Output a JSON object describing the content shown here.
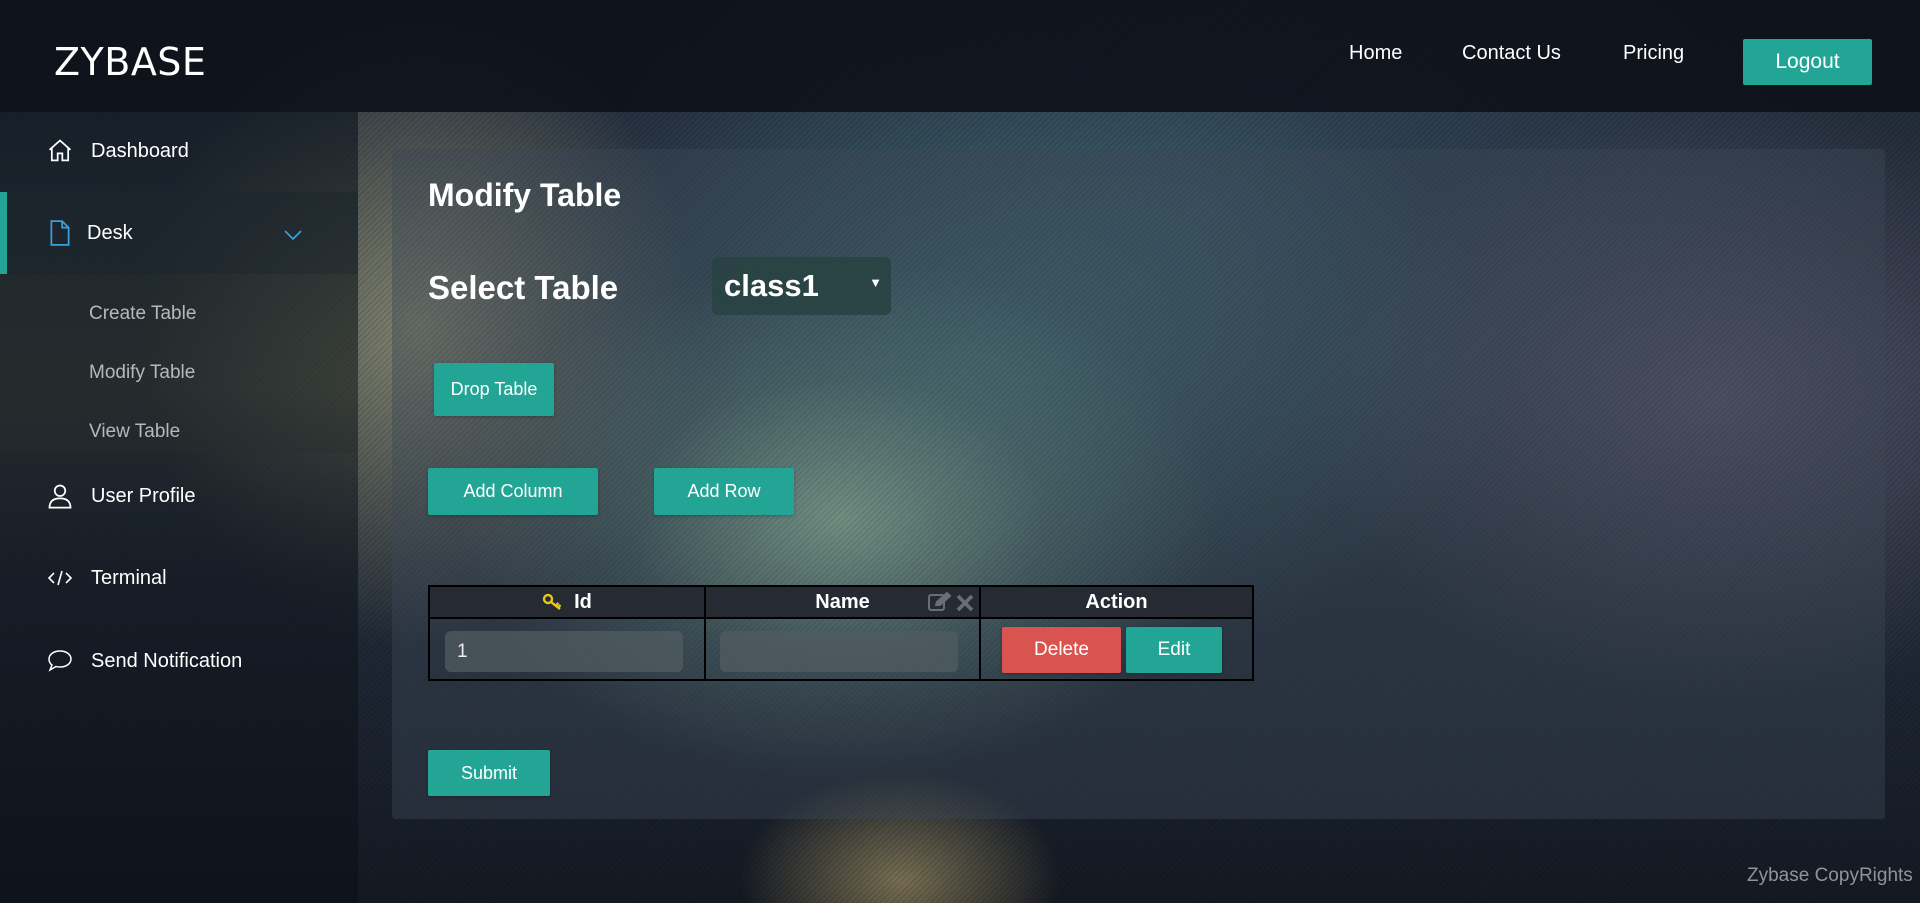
{
  "app": {
    "brand": "ZYBASE"
  },
  "nav": {
    "home": "Home",
    "contact": "Contact Us",
    "pricing": "Pricing",
    "logout": "Logout"
  },
  "sidebar": {
    "dashboard": "Dashboard",
    "desk": "Desk",
    "submenu": [
      "Create Table",
      "Modify Table",
      "View Table"
    ],
    "user_profile": "User Profile",
    "terminal": "Terminal",
    "send_notification": "Send Notification"
  },
  "main": {
    "title": "Modify Table",
    "select_label": "Select Table",
    "selected_table": "class1",
    "drop_table": "Drop Table",
    "add_column": "Add Column",
    "add_row": "Add Row",
    "submit": "Submit"
  },
  "table": {
    "headers": [
      "Id",
      "Name",
      "Action"
    ],
    "rows": [
      {
        "id": "1",
        "name": "",
        "delete": "Delete",
        "edit": "Edit"
      }
    ]
  },
  "footer": {
    "copyright": "Zybase CopyRights"
  },
  "colors": {
    "accent": "#23a595",
    "danger": "#d9534f",
    "key_icon": "#e6c619"
  }
}
